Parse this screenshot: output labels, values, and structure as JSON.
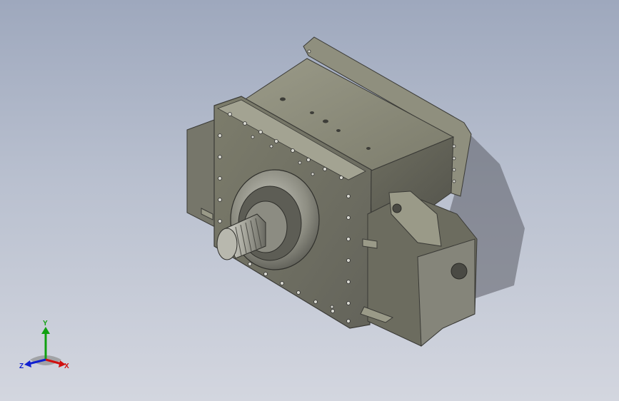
{
  "viewport": {
    "background_top": "#9ea8bd",
    "background_bottom": "#d3d6df",
    "model_color": "#8a8a78",
    "model_shadow": "#5b5d66"
  },
  "triad": {
    "x_label": "X",
    "y_label": "Y",
    "z_label": "Z",
    "x_color": "#d01010",
    "y_color": "#10a010",
    "z_color": "#1020d0"
  }
}
